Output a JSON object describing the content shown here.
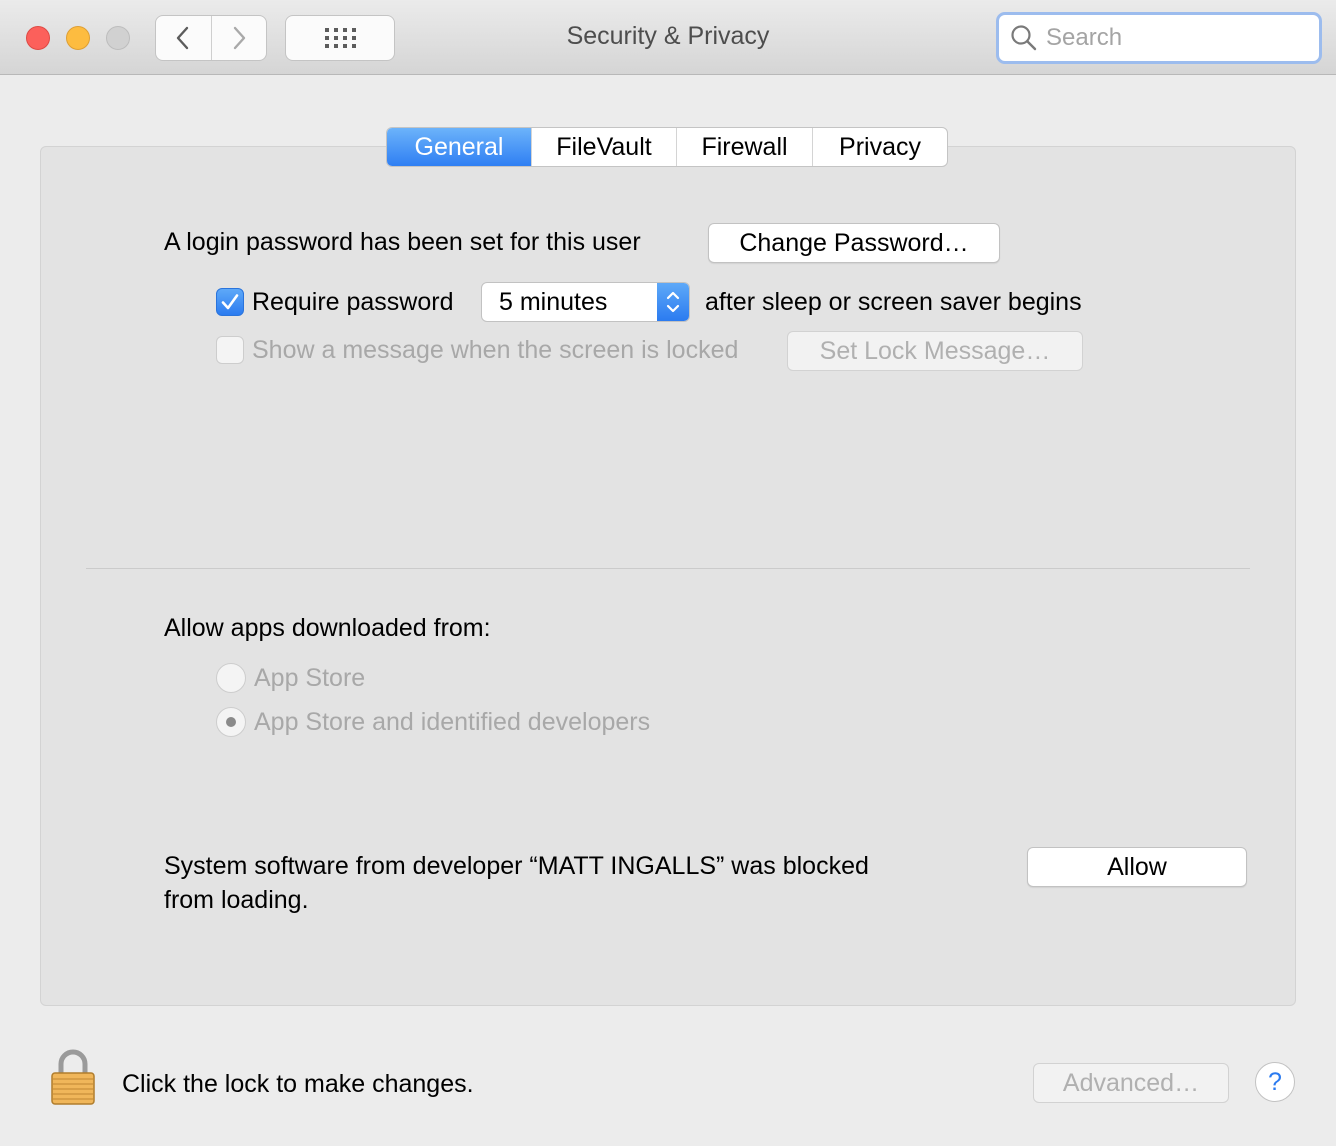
{
  "window": {
    "title": "Security & Privacy",
    "search_placeholder": "Search"
  },
  "tabs": [
    {
      "label": "General",
      "active": true
    },
    {
      "label": "FileVault",
      "active": false
    },
    {
      "label": "Firewall",
      "active": false
    },
    {
      "label": "Privacy",
      "active": false
    }
  ],
  "general": {
    "login_text": "A login password has been set for this user",
    "change_password_label": "Change Password…",
    "require_password_label": "Require password",
    "require_password_checked": true,
    "require_password_delay": "5 minutes",
    "after_sleep_text": "after sleep or screen saver begins",
    "show_message_label": "Show a message when the screen is locked",
    "show_message_checked": false,
    "set_lock_message_label": "Set Lock Message…"
  },
  "downloads": {
    "heading": "Allow apps downloaded from:",
    "options": [
      {
        "label": "App Store",
        "selected": false
      },
      {
        "label": "App Store and identified developers",
        "selected": true
      }
    ]
  },
  "blocked": {
    "line1": "System software from developer “MATT INGALLS” was blocked",
    "line2": "from loading.",
    "allow_label": "Allow"
  },
  "footer": {
    "lock_text": "Click the lock to make changes.",
    "advanced_label": "Advanced…",
    "help_label": "?"
  },
  "colors": {
    "accent": "#2b7bf0",
    "close": "#fc605b",
    "minimize": "#fdbc40",
    "zoom_disabled": "#d1d1d1"
  },
  "icons": [
    "back-chevron-icon",
    "forward-chevron-icon",
    "grid-icon",
    "search-icon",
    "checkmark-icon",
    "stepper-arrows-icon",
    "lock-icon"
  ]
}
